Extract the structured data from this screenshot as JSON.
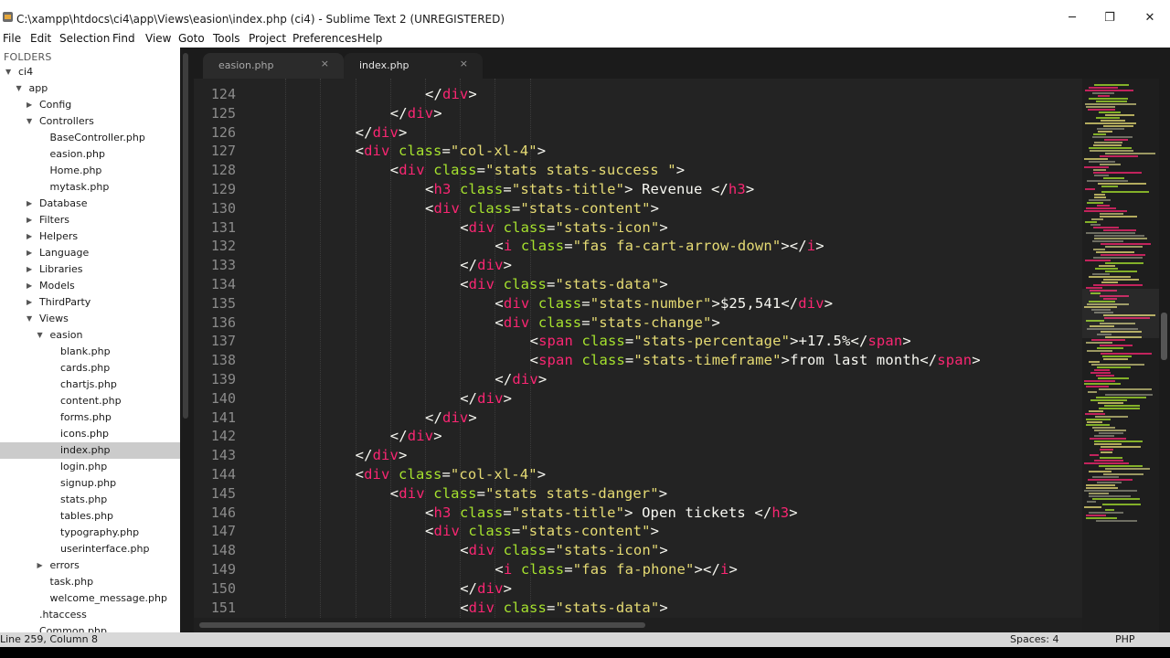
{
  "window": {
    "title": "C:\\xampp\\htdocs\\ci4\\app\\Views\\easion\\index.php (ci4) - Sublime Text 2 (UNREGISTERED)",
    "minimize_glyph": "─",
    "maximize_glyph": "❐",
    "close_glyph": "✕"
  },
  "menu": [
    "File",
    "Edit",
    "Selection",
    "Find",
    "View",
    "Goto",
    "Tools",
    "Project",
    "Preferences",
    "Help"
  ],
  "sidebar": {
    "header": "FOLDERS",
    "items": [
      {
        "label": "ci4",
        "depth": 0,
        "arrow": "open"
      },
      {
        "label": "app",
        "depth": 1,
        "arrow": "open"
      },
      {
        "label": "Config",
        "depth": 2,
        "arrow": "closed"
      },
      {
        "label": "Controllers",
        "depth": 2,
        "arrow": "open"
      },
      {
        "label": "BaseController.php",
        "depth": 3,
        "arrow": "none"
      },
      {
        "label": "easion.php",
        "depth": 3,
        "arrow": "none"
      },
      {
        "label": "Home.php",
        "depth": 3,
        "arrow": "none"
      },
      {
        "label": "mytask.php",
        "depth": 3,
        "arrow": "none"
      },
      {
        "label": "Database",
        "depth": 2,
        "arrow": "closed"
      },
      {
        "label": "Filters",
        "depth": 2,
        "arrow": "closed"
      },
      {
        "label": "Helpers",
        "depth": 2,
        "arrow": "closed"
      },
      {
        "label": "Language",
        "depth": 2,
        "arrow": "closed"
      },
      {
        "label": "Libraries",
        "depth": 2,
        "arrow": "closed"
      },
      {
        "label": "Models",
        "depth": 2,
        "arrow": "closed"
      },
      {
        "label": "ThirdParty",
        "depth": 2,
        "arrow": "closed"
      },
      {
        "label": "Views",
        "depth": 2,
        "arrow": "open"
      },
      {
        "label": "easion",
        "depth": 3,
        "arrow": "open"
      },
      {
        "label": "blank.php",
        "depth": 4,
        "arrow": "none"
      },
      {
        "label": "cards.php",
        "depth": 4,
        "arrow": "none"
      },
      {
        "label": "chartjs.php",
        "depth": 4,
        "arrow": "none"
      },
      {
        "label": "content.php",
        "depth": 4,
        "arrow": "none"
      },
      {
        "label": "forms.php",
        "depth": 4,
        "arrow": "none"
      },
      {
        "label": "icons.php",
        "depth": 4,
        "arrow": "none"
      },
      {
        "label": "index.php",
        "depth": 4,
        "arrow": "none",
        "selected": true
      },
      {
        "label": "login.php",
        "depth": 4,
        "arrow": "none"
      },
      {
        "label": "signup.php",
        "depth": 4,
        "arrow": "none"
      },
      {
        "label": "stats.php",
        "depth": 4,
        "arrow": "none"
      },
      {
        "label": "tables.php",
        "depth": 4,
        "arrow": "none"
      },
      {
        "label": "typography.php",
        "depth": 4,
        "arrow": "none"
      },
      {
        "label": "userinterface.php",
        "depth": 4,
        "arrow": "none"
      },
      {
        "label": "errors",
        "depth": 3,
        "arrow": "closed"
      },
      {
        "label": "task.php",
        "depth": 3,
        "arrow": "none"
      },
      {
        "label": "welcome_message.php",
        "depth": 3,
        "arrow": "none"
      },
      {
        "label": ".htaccess",
        "depth": 2,
        "arrow": "none"
      },
      {
        "label": "Common.php",
        "depth": 2,
        "arrow": "none"
      }
    ]
  },
  "tabs": [
    {
      "label": "easion.php",
      "active": false,
      "close": "×"
    },
    {
      "label": "index.php",
      "active": true,
      "close": "×"
    }
  ],
  "editor": {
    "lines": [
      {
        "num": "124",
        "indent": 5,
        "tokens": [
          [
            "p",
            "</"
          ],
          [
            "t",
            "div"
          ],
          [
            "p",
            ">"
          ]
        ]
      },
      {
        "num": "125",
        "indent": 4,
        "tokens": [
          [
            "p",
            "</"
          ],
          [
            "t",
            "div"
          ],
          [
            "p",
            ">"
          ]
        ]
      },
      {
        "num": "126",
        "indent": 3,
        "tokens": [
          [
            "p",
            "</"
          ],
          [
            "t",
            "div"
          ],
          [
            "p",
            ">"
          ]
        ]
      },
      {
        "num": "127",
        "indent": 3,
        "tokens": [
          [
            "p",
            "<"
          ],
          [
            "t",
            "div"
          ],
          [
            "p",
            " "
          ],
          [
            "a",
            "class"
          ],
          [
            "p",
            "="
          ],
          [
            "s",
            "\"col-xl-4\""
          ],
          [
            "p",
            ">"
          ]
        ]
      },
      {
        "num": "128",
        "indent": 4,
        "tokens": [
          [
            "p",
            "<"
          ],
          [
            "t",
            "div"
          ],
          [
            "p",
            " "
          ],
          [
            "a",
            "class"
          ],
          [
            "p",
            "="
          ],
          [
            "s",
            "\"stats stats-success \""
          ],
          [
            "p",
            ">"
          ]
        ]
      },
      {
        "num": "129",
        "indent": 5,
        "tokens": [
          [
            "p",
            "<"
          ],
          [
            "t",
            "h3"
          ],
          [
            "p",
            " "
          ],
          [
            "a",
            "class"
          ],
          [
            "p",
            "="
          ],
          [
            "s",
            "\"stats-title\""
          ],
          [
            "p",
            ">"
          ],
          [
            "x",
            " Revenue "
          ],
          [
            "p",
            "</"
          ],
          [
            "t",
            "h3"
          ],
          [
            "p",
            ">"
          ]
        ]
      },
      {
        "num": "130",
        "indent": 5,
        "tokens": [
          [
            "p",
            "<"
          ],
          [
            "t",
            "div"
          ],
          [
            "p",
            " "
          ],
          [
            "a",
            "class"
          ],
          [
            "p",
            "="
          ],
          [
            "s",
            "\"stats-content\""
          ],
          [
            "p",
            ">"
          ]
        ]
      },
      {
        "num": "131",
        "indent": 6,
        "tokens": [
          [
            "p",
            "<"
          ],
          [
            "t",
            "div"
          ],
          [
            "p",
            " "
          ],
          [
            "a",
            "class"
          ],
          [
            "p",
            "="
          ],
          [
            "s",
            "\"stats-icon\""
          ],
          [
            "p",
            ">"
          ]
        ]
      },
      {
        "num": "132",
        "indent": 7,
        "tokens": [
          [
            "p",
            "<"
          ],
          [
            "t",
            "i"
          ],
          [
            "p",
            " "
          ],
          [
            "a",
            "class"
          ],
          [
            "p",
            "="
          ],
          [
            "s",
            "\"fas fa-cart-arrow-down\""
          ],
          [
            "p",
            "></"
          ],
          [
            "t",
            "i"
          ],
          [
            "p",
            ">"
          ]
        ]
      },
      {
        "num": "133",
        "indent": 6,
        "tokens": [
          [
            "p",
            "</"
          ],
          [
            "t",
            "div"
          ],
          [
            "p",
            ">"
          ]
        ]
      },
      {
        "num": "134",
        "indent": 6,
        "tokens": [
          [
            "p",
            "<"
          ],
          [
            "t",
            "div"
          ],
          [
            "p",
            " "
          ],
          [
            "a",
            "class"
          ],
          [
            "p",
            "="
          ],
          [
            "s",
            "\"stats-data\""
          ],
          [
            "p",
            ">"
          ]
        ]
      },
      {
        "num": "135",
        "indent": 7,
        "tokens": [
          [
            "p",
            "<"
          ],
          [
            "t",
            "div"
          ],
          [
            "p",
            " "
          ],
          [
            "a",
            "class"
          ],
          [
            "p",
            "="
          ],
          [
            "s",
            "\"stats-number\""
          ],
          [
            "p",
            ">"
          ],
          [
            "x",
            "$25,541"
          ],
          [
            "p",
            "</"
          ],
          [
            "t",
            "div"
          ],
          [
            "p",
            ">"
          ]
        ]
      },
      {
        "num": "136",
        "indent": 7,
        "tokens": [
          [
            "p",
            "<"
          ],
          [
            "t",
            "div"
          ],
          [
            "p",
            " "
          ],
          [
            "a",
            "class"
          ],
          [
            "p",
            "="
          ],
          [
            "s",
            "\"stats-change\""
          ],
          [
            "p",
            ">"
          ]
        ]
      },
      {
        "num": "137",
        "indent": 8,
        "tokens": [
          [
            "p",
            "<"
          ],
          [
            "t",
            "span"
          ],
          [
            "p",
            " "
          ],
          [
            "a",
            "class"
          ],
          [
            "p",
            "="
          ],
          [
            "s",
            "\"stats-percentage\""
          ],
          [
            "p",
            ">"
          ],
          [
            "x",
            "+17.5%"
          ],
          [
            "p",
            "</"
          ],
          [
            "t",
            "span"
          ],
          [
            "p",
            ">"
          ]
        ]
      },
      {
        "num": "138",
        "indent": 8,
        "tokens": [
          [
            "p",
            "<"
          ],
          [
            "t",
            "span"
          ],
          [
            "p",
            " "
          ],
          [
            "a",
            "class"
          ],
          [
            "p",
            "="
          ],
          [
            "s",
            "\"stats-timeframe\""
          ],
          [
            "p",
            ">"
          ],
          [
            "x",
            "from last month"
          ],
          [
            "p",
            "</"
          ],
          [
            "t",
            "span"
          ],
          [
            "p",
            ">"
          ]
        ]
      },
      {
        "num": "139",
        "indent": 7,
        "tokens": [
          [
            "p",
            "</"
          ],
          [
            "t",
            "div"
          ],
          [
            "p",
            ">"
          ]
        ]
      },
      {
        "num": "140",
        "indent": 6,
        "tokens": [
          [
            "p",
            "</"
          ],
          [
            "t",
            "div"
          ],
          [
            "p",
            ">"
          ]
        ]
      },
      {
        "num": "141",
        "indent": 5,
        "tokens": [
          [
            "p",
            "</"
          ],
          [
            "t",
            "div"
          ],
          [
            "p",
            ">"
          ]
        ]
      },
      {
        "num": "142",
        "indent": 4,
        "tokens": [
          [
            "p",
            "</"
          ],
          [
            "t",
            "div"
          ],
          [
            "p",
            ">"
          ]
        ]
      },
      {
        "num": "143",
        "indent": 3,
        "tokens": [
          [
            "p",
            "</"
          ],
          [
            "t",
            "div"
          ],
          [
            "p",
            ">"
          ]
        ]
      },
      {
        "num": "144",
        "indent": 3,
        "tokens": [
          [
            "p",
            "<"
          ],
          [
            "t",
            "div"
          ],
          [
            "p",
            " "
          ],
          [
            "a",
            "class"
          ],
          [
            "p",
            "="
          ],
          [
            "s",
            "\"col-xl-4\""
          ],
          [
            "p",
            ">"
          ]
        ]
      },
      {
        "num": "145",
        "indent": 4,
        "tokens": [
          [
            "p",
            "<"
          ],
          [
            "t",
            "div"
          ],
          [
            "p",
            " "
          ],
          [
            "a",
            "class"
          ],
          [
            "p",
            "="
          ],
          [
            "s",
            "\"stats stats-danger\""
          ],
          [
            "p",
            ">"
          ]
        ]
      },
      {
        "num": "146",
        "indent": 5,
        "tokens": [
          [
            "p",
            "<"
          ],
          [
            "t",
            "h3"
          ],
          [
            "p",
            " "
          ],
          [
            "a",
            "class"
          ],
          [
            "p",
            "="
          ],
          [
            "s",
            "\"stats-title\""
          ],
          [
            "p",
            ">"
          ],
          [
            "x",
            " Open tickets "
          ],
          [
            "p",
            "</"
          ],
          [
            "t",
            "h3"
          ],
          [
            "p",
            ">"
          ]
        ]
      },
      {
        "num": "147",
        "indent": 5,
        "tokens": [
          [
            "p",
            "<"
          ],
          [
            "t",
            "div"
          ],
          [
            "p",
            " "
          ],
          [
            "a",
            "class"
          ],
          [
            "p",
            "="
          ],
          [
            "s",
            "\"stats-content\""
          ],
          [
            "p",
            ">"
          ]
        ]
      },
      {
        "num": "148",
        "indent": 6,
        "tokens": [
          [
            "p",
            "<"
          ],
          [
            "t",
            "div"
          ],
          [
            "p",
            " "
          ],
          [
            "a",
            "class"
          ],
          [
            "p",
            "="
          ],
          [
            "s",
            "\"stats-icon\""
          ],
          [
            "p",
            ">"
          ]
        ]
      },
      {
        "num": "149",
        "indent": 7,
        "tokens": [
          [
            "p",
            "<"
          ],
          [
            "t",
            "i"
          ],
          [
            "p",
            " "
          ],
          [
            "a",
            "class"
          ],
          [
            "p",
            "="
          ],
          [
            "s",
            "\"fas fa-phone\""
          ],
          [
            "p",
            "></"
          ],
          [
            "t",
            "i"
          ],
          [
            "p",
            ">"
          ]
        ]
      },
      {
        "num": "150",
        "indent": 6,
        "tokens": [
          [
            "p",
            "</"
          ],
          [
            "t",
            "div"
          ],
          [
            "p",
            ">"
          ]
        ]
      },
      {
        "num": "151",
        "indent": 6,
        "tokens": [
          [
            "p",
            "<"
          ],
          [
            "t",
            "div"
          ],
          [
            "p",
            " "
          ],
          [
            "a",
            "class"
          ],
          [
            "p",
            "="
          ],
          [
            "s",
            "\"stats-data\""
          ],
          [
            "p",
            ">"
          ]
        ]
      }
    ]
  },
  "status": {
    "position": "Line 259, Column 8",
    "spaces": "Spaces: 4",
    "syntax": "PHP"
  },
  "colors": {
    "tag": "#f92672",
    "attribute": "#a6e22e",
    "string": "#e6db74",
    "text": "#f8f8f2",
    "editor_bg": "#232323"
  }
}
